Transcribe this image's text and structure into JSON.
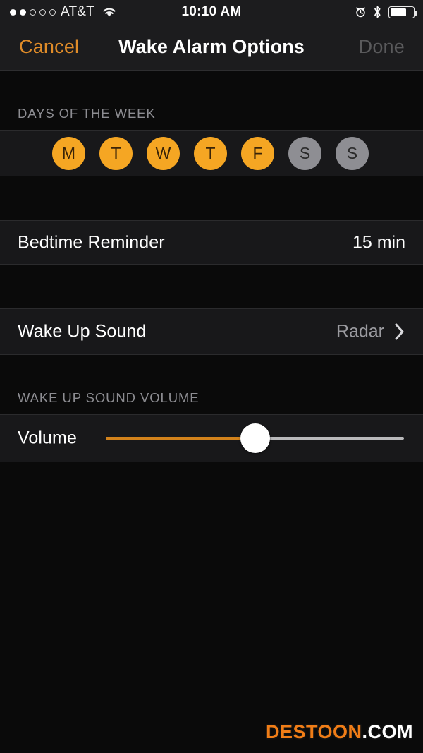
{
  "status_bar": {
    "signal_dots_filled": 2,
    "signal_dots_total": 5,
    "carrier": "AT&T",
    "time": "10:10 AM",
    "battery_percent": 72,
    "icons": [
      "wifi-icon",
      "alarm-clock-icon",
      "bluetooth-icon",
      "battery-icon"
    ]
  },
  "nav_bar": {
    "cancel_label": "Cancel",
    "title": "Wake Alarm Options",
    "done_label": "Done",
    "cancel_color": "#e08c29",
    "done_color": "#5a5a5c"
  },
  "sections": {
    "days": {
      "header": "DAYS OF THE WEEK",
      "items": [
        {
          "letter": "M",
          "day": "Monday",
          "selected": true
        },
        {
          "letter": "T",
          "day": "Tuesday",
          "selected": true
        },
        {
          "letter": "W",
          "day": "Wednesday",
          "selected": true
        },
        {
          "letter": "T",
          "day": "Thursday",
          "selected": true
        },
        {
          "letter": "F",
          "day": "Friday",
          "selected": true
        },
        {
          "letter": "S",
          "day": "Saturday",
          "selected": false
        },
        {
          "letter": "S",
          "day": "Sunday",
          "selected": false
        }
      ],
      "selected_color": "#f5a623",
      "unselected_color": "#8e8e93"
    },
    "bedtime": {
      "label": "Bedtime Reminder",
      "value": "15 min"
    },
    "sound": {
      "label": "Wake Up Sound",
      "value": "Radar",
      "disclosure_icon": "chevron-right-icon"
    },
    "volume": {
      "header": "WAKE UP SOUND VOLUME",
      "label": "Volume",
      "value_percent": 50,
      "fill_color": "#d2821b",
      "track_color": "#b9b9bb"
    }
  },
  "watermark": {
    "primary": "DESTOON",
    "secondary": ".COM",
    "primary_color": "#f07d17",
    "secondary_color": "#ffffff"
  }
}
